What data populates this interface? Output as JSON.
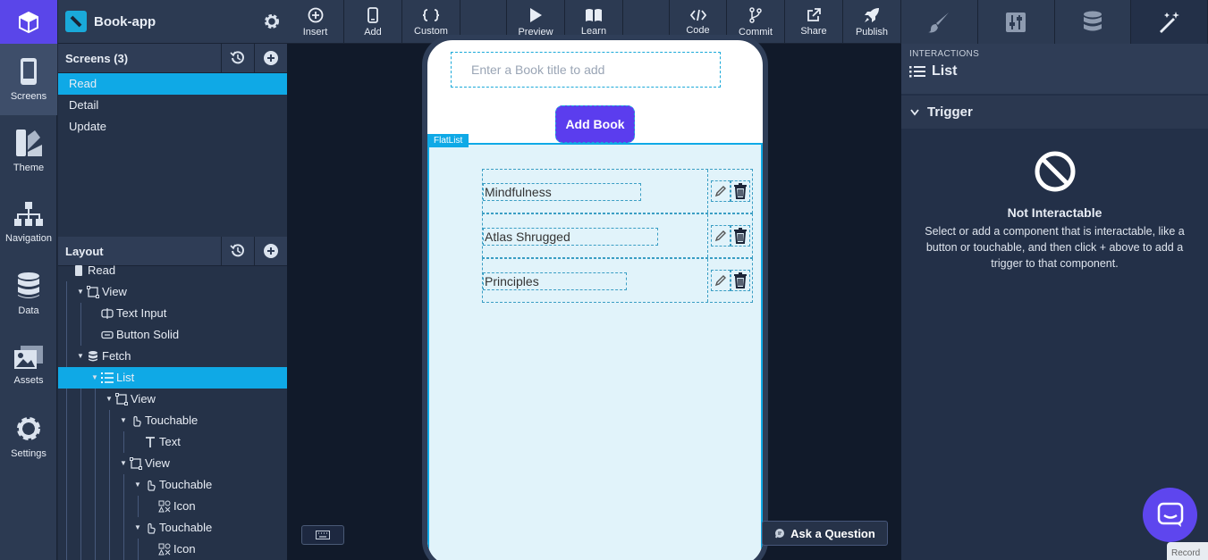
{
  "rail": {
    "items": [
      {
        "label": "Screens",
        "icon": "phone-icon"
      },
      {
        "label": "Theme",
        "icon": "theme-icon"
      },
      {
        "label": "Navigation",
        "icon": "sitemap-icon"
      },
      {
        "label": "Data",
        "icon": "database-icon"
      },
      {
        "label": "Assets",
        "icon": "images-icon"
      },
      {
        "label": "Settings",
        "icon": "gear-icon"
      }
    ]
  },
  "project": {
    "name": "Book-app"
  },
  "screens": {
    "header": "Screens (3)",
    "items": [
      "Read",
      "Detail",
      "Update"
    ],
    "selected": "Read"
  },
  "layout": {
    "header": "Layout",
    "tree": [
      {
        "label": "Read",
        "depth": 0,
        "icon": "screen-icon",
        "caret": false
      },
      {
        "label": "View",
        "depth": 1,
        "icon": "view-icon",
        "caret": true
      },
      {
        "label": "Text Input",
        "depth": 2,
        "icon": "text-input-icon",
        "caret": false
      },
      {
        "label": "Button Solid",
        "depth": 2,
        "icon": "button-icon",
        "caret": false
      },
      {
        "label": "Fetch",
        "depth": 1,
        "icon": "database-icon",
        "caret": true
      },
      {
        "label": "List",
        "depth": 2,
        "icon": "list-icon",
        "caret": true,
        "selected": true
      },
      {
        "label": "View",
        "depth": 3,
        "icon": "view-icon",
        "caret": true
      },
      {
        "label": "Touchable",
        "depth": 4,
        "icon": "touch-icon",
        "caret": true
      },
      {
        "label": "Text",
        "depth": 5,
        "icon": "text-icon",
        "caret": false
      },
      {
        "label": "View",
        "depth": 4,
        "icon": "view-icon",
        "caret": true
      },
      {
        "label": "Touchable",
        "depth": 5,
        "icon": "touch-icon",
        "caret": true
      },
      {
        "label": "Icon",
        "depth": 6,
        "icon": "icon-icon",
        "caret": false
      },
      {
        "label": "Touchable",
        "depth": 5,
        "icon": "touch-icon",
        "caret": true
      },
      {
        "label": "Icon",
        "depth": 6,
        "icon": "icon-icon",
        "caret": false
      }
    ]
  },
  "toolbar": {
    "items": [
      {
        "label": "Insert",
        "icon": "plus-circle-icon"
      },
      {
        "label": "Add",
        "icon": "phone-add-icon"
      },
      {
        "label": "Custom",
        "icon": "braces-icon"
      },
      {
        "label": "",
        "icon": ""
      },
      {
        "label": "Preview",
        "icon": "play-icon"
      },
      {
        "label": "Learn",
        "icon": "book-open-icon"
      },
      {
        "label": "",
        "icon": ""
      },
      {
        "label": "Code",
        "icon": "code-icon"
      },
      {
        "label": "Commit",
        "icon": "branch-icon"
      },
      {
        "label": "Share",
        "icon": "share-icon"
      },
      {
        "label": "Publish",
        "icon": "rocket-icon"
      }
    ]
  },
  "phone": {
    "input_placeholder": "Enter a Book title to add",
    "add_button": "Add Book",
    "flatlist_tag": "FlatList",
    "books": [
      "Mindfulness",
      "Atlas Shrugged",
      "Principles"
    ]
  },
  "canvas": {
    "ask_button": "Ask a Question"
  },
  "right": {
    "tabs": [
      "brush-icon",
      "sliders-icon",
      "database-icon",
      "magic-wand-icon"
    ],
    "section_label": "INTERACTIONS",
    "component": "List",
    "trigger_label": "Trigger",
    "empty_title": "Not Interactable",
    "empty_desc": "Select or add a component that is interactable, like a button or touchable, and then click + above to add a trigger to that component.",
    "record_label": "Record"
  },
  "colors": {
    "accent": "#5b3dee",
    "selection": "#0fa9e6",
    "canvas": "#111a2a"
  }
}
